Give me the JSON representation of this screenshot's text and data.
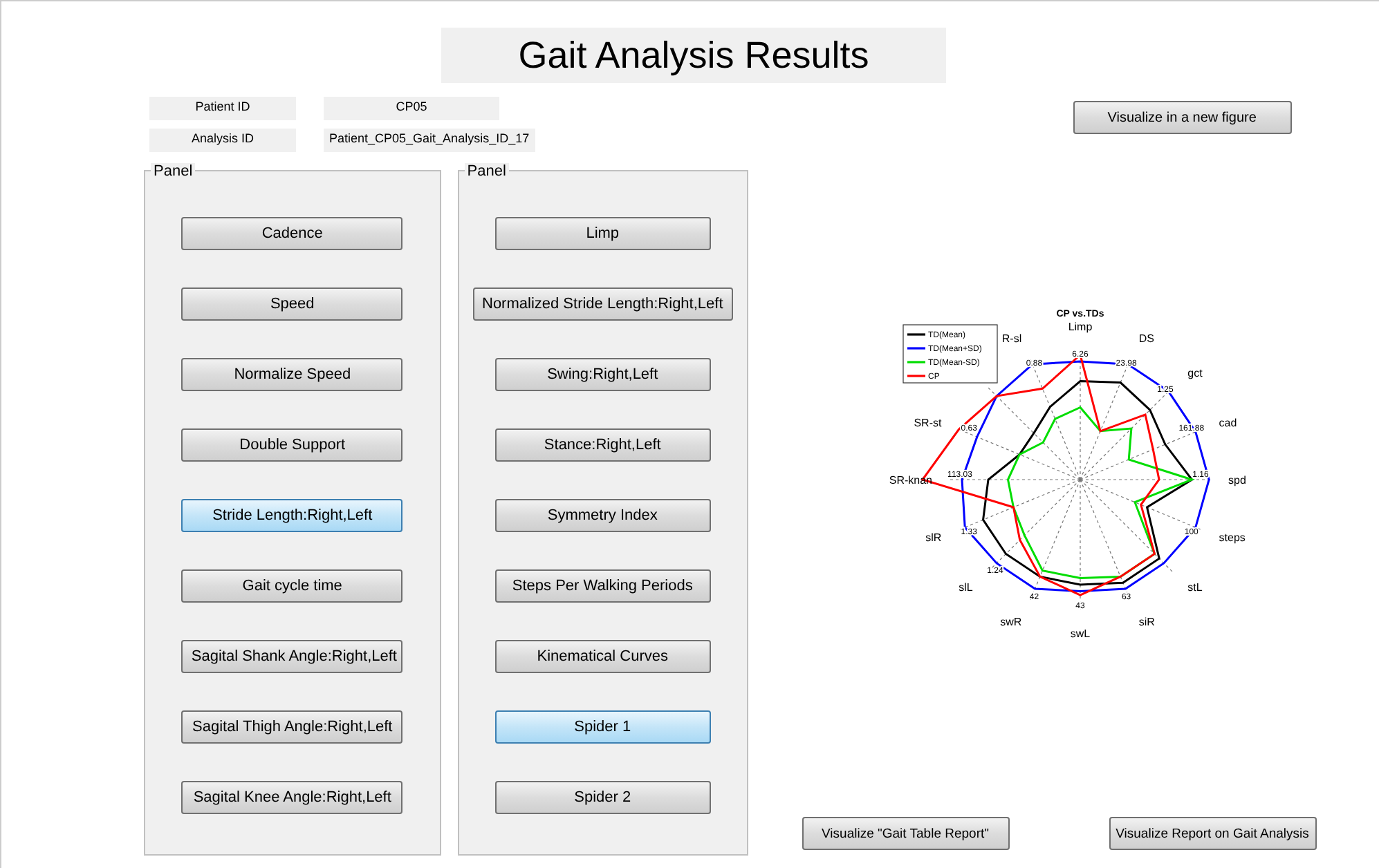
{
  "title": "Gait Analysis Results",
  "info": [
    {
      "label": "Patient ID",
      "value": "CP05"
    },
    {
      "label": "Analysis ID",
      "value": "Patient_CP05_Gait_Analysis_ID_17"
    }
  ],
  "new_figure_button": "Visualize in a new figure",
  "panels": [
    {
      "title": "Panel",
      "buttons": [
        {
          "label": "Cadence",
          "selected": false
        },
        {
          "label": "Speed",
          "selected": false
        },
        {
          "label": "Normalize Speed",
          "selected": false
        },
        {
          "label": "Double Support",
          "selected": false
        },
        {
          "label": "Stride Length:Right,Left",
          "selected": true
        },
        {
          "label": "Gait cycle time",
          "selected": false
        },
        {
          "label": "Sagital Shank Angle:Right,Left",
          "selected": false
        },
        {
          "label": "Sagital Thigh Angle:Right,Left",
          "selected": false
        },
        {
          "label": "Sagital Knee Angle:Right,Left",
          "selected": false
        }
      ]
    },
    {
      "title": "Panel",
      "buttons": [
        {
          "label": "Limp",
          "selected": false
        },
        {
          "label": "Normalized Stride Length:Right,Left",
          "selected": false
        },
        {
          "label": "Swing:Right,Left",
          "selected": false
        },
        {
          "label": "Stance:Right,Left",
          "selected": false
        },
        {
          "label": "Symmetry Index",
          "selected": false
        },
        {
          "label": "Steps Per Walking Periods",
          "selected": false
        },
        {
          "label": "Kinematical Curves",
          "selected": false
        },
        {
          "label": "Spider 1",
          "selected": true
        },
        {
          "label": "Spider 2",
          "selected": false
        }
      ]
    }
  ],
  "chart": {
    "title": "CP vs.TDs",
    "legend": [
      {
        "label": "TD(Mean)",
        "color": "#000000"
      },
      {
        "label": "TD(Mean+SD)",
        "color": "#0000ff"
      },
      {
        "label": "TD(Mean-SD)",
        "color": "#00dd00"
      },
      {
        "label": "CP",
        "color": "#ff0000"
      }
    ],
    "axes_left": [
      {
        "label": "R-sl",
        "value": "0.88"
      },
      {
        "label": "SR-st",
        "value": "0.63"
      },
      {
        "label": "SR-knan",
        "value": "113.03"
      },
      {
        "label": "slR",
        "value": "1.33"
      },
      {
        "label": "slL",
        "value": "1.24"
      },
      {
        "label": "swR",
        "value": "42"
      }
    ],
    "axes_right": [
      {
        "label": "Limp",
        "value": "6.26"
      },
      {
        "label": "DS",
        "value": "23.98"
      },
      {
        "label": "gct",
        "value": "1.25"
      },
      {
        "label": "cad",
        "value": "161.88"
      },
      {
        "label": "spd",
        "value": "1.16"
      },
      {
        "label": "steps",
        "value": "100"
      },
      {
        "label": "stL"
      },
      {
        "label": "siR",
        "value": "63"
      },
      {
        "label": "swL",
        "value": "43"
      }
    ]
  },
  "bottom_buttons": [
    "Visualize \"Gait Table Report\"",
    "Visualize Report on Gait Analysis"
  ]
}
